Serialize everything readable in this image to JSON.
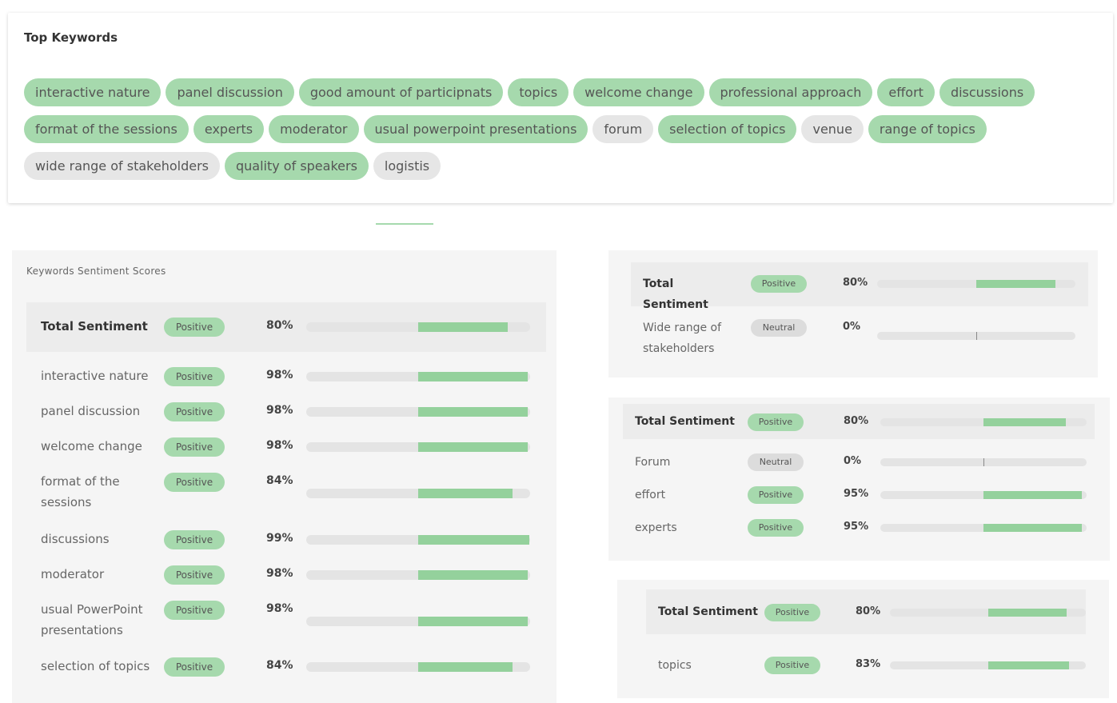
{
  "top_keywords": {
    "title": "Top Keywords",
    "chips": [
      {
        "label": "interactive nature",
        "tone": "green"
      },
      {
        "label": "panel discussion",
        "tone": "green"
      },
      {
        "label": "good amount of participnats",
        "tone": "green"
      },
      {
        "label": "topics",
        "tone": "green"
      },
      {
        "label": "welcome change",
        "tone": "green"
      },
      {
        "label": "professional approach",
        "tone": "green"
      },
      {
        "label": "effort",
        "tone": "green"
      },
      {
        "label": "discussions",
        "tone": "green"
      },
      {
        "label": "format of the sessions",
        "tone": "green"
      },
      {
        "label": "experts",
        "tone": "green"
      },
      {
        "label": "moderator",
        "tone": "green"
      },
      {
        "label": "usual powerpoint presentations",
        "tone": "green"
      },
      {
        "label": "forum",
        "tone": "gray"
      },
      {
        "label": "selection of topics",
        "tone": "green"
      },
      {
        "label": "venue",
        "tone": "gray"
      },
      {
        "label": "range of topics",
        "tone": "green"
      },
      {
        "label": "wide range of stakeholders",
        "tone": "gray"
      },
      {
        "label": "quality of speakers",
        "tone": "green"
      },
      {
        "label": "logistis",
        "tone": "gray"
      }
    ]
  },
  "colors": {
    "positive": "#a6d9ad",
    "neutral": "#dcdcdc",
    "bar_fill": "#94d19c",
    "bar_track": "#e4e4e4"
  },
  "panel_main": {
    "title": "Keywords Sentiment Scores",
    "rows": [
      {
        "label": "Total Sentiment",
        "badge": "Positive",
        "pct": "80%",
        "score": 0.8,
        "total": true
      },
      {
        "label": "interactive nature",
        "badge": "Positive",
        "pct": "98%",
        "score": 0.98
      },
      {
        "label": "panel discussion",
        "badge": "Positive",
        "pct": "98%",
        "score": 0.98
      },
      {
        "label": "welcome change",
        "badge": "Positive",
        "pct": "98%",
        "score": 0.98
      },
      {
        "label": "format of the sessions",
        "badge": "Positive",
        "pct": "84%",
        "score": 0.84
      },
      {
        "label": "discussions",
        "badge": "Positive",
        "pct": "99%",
        "score": 0.99
      },
      {
        "label": "moderator",
        "badge": "Positive",
        "pct": "98%",
        "score": 0.98
      },
      {
        "label": "usual PowerPoint presentations",
        "badge": "Positive",
        "pct": "98%",
        "score": 0.98
      },
      {
        "label": "selection of topics",
        "badge": "Positive",
        "pct": "84%",
        "score": 0.84
      }
    ]
  },
  "panel_a": {
    "rows": [
      {
        "label": "Total Sentiment",
        "badge": "Positive",
        "pct": "80%",
        "score": 0.8,
        "total": true
      },
      {
        "label": "Wide range of stakeholders",
        "badge": "Neutral",
        "pct": "0%",
        "score": 0
      }
    ]
  },
  "panel_b": {
    "rows": [
      {
        "label": "Total Sentiment",
        "badge": "Positive",
        "pct": "80%",
        "score": 0.8,
        "total": true
      },
      {
        "label": "Forum",
        "badge": "Neutral",
        "pct": "0%",
        "score": 0
      },
      {
        "label": "effort",
        "badge": "Positive",
        "pct": "95%",
        "score": 0.95
      },
      {
        "label": "experts",
        "badge": "Positive",
        "pct": "95%",
        "score": 0.95
      }
    ]
  },
  "panel_c": {
    "rows": [
      {
        "label": "Total Sentiment",
        "badge": "Positive",
        "pct": "80%",
        "score": 0.8,
        "total": true
      },
      {
        "label": "topics",
        "badge": "Positive",
        "pct": "83%",
        "score": 0.83
      }
    ]
  }
}
